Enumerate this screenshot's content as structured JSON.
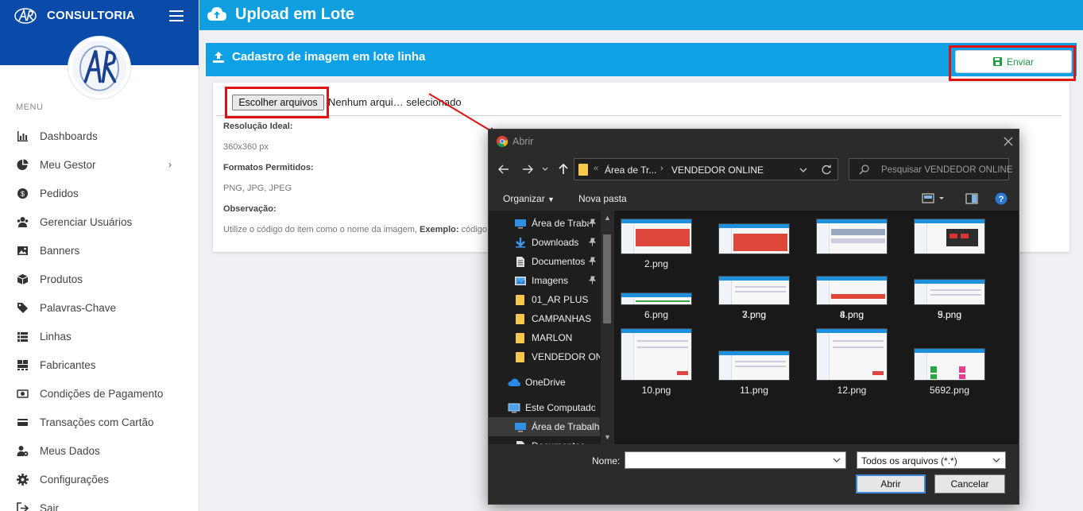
{
  "brand": {
    "name": "CONSULTORIA"
  },
  "sidebar": {
    "menu_title": "MENU",
    "items": [
      {
        "label": "Dashboards",
        "icon": "bar-chart-icon"
      },
      {
        "label": "Meu Gestor",
        "icon": "pie-chart-icon",
        "has_chevron": true
      },
      {
        "label": "Pedidos",
        "icon": "money-icon"
      },
      {
        "label": "Gerenciar Usuários",
        "icon": "users-icon"
      },
      {
        "label": "Banners",
        "icon": "image-icon"
      },
      {
        "label": "Produtos",
        "icon": "box-icon"
      },
      {
        "label": "Palavras-Chave",
        "icon": "tags-icon"
      },
      {
        "label": "Linhas",
        "icon": "list-icon"
      },
      {
        "label": "Fabricantes",
        "icon": "pallet-icon"
      },
      {
        "label": "Condições de Pagamento",
        "icon": "bill-icon"
      },
      {
        "label": "Transações com Cartão",
        "icon": "credit-card-icon"
      },
      {
        "label": "Meus Dados",
        "icon": "user-gear-icon"
      },
      {
        "label": "Configurações",
        "icon": "gear-icon"
      },
      {
        "label": "Sair",
        "icon": "exit-icon"
      }
    ]
  },
  "header": {
    "title": "Upload em Lote"
  },
  "panel": {
    "title": "Cadastro de imagem em lote linha",
    "send_label": "Enviar",
    "file_button": "Escolher arquivos",
    "file_status": "Nenhum arqui… selecionado",
    "res_label": "Resolução Ideal:",
    "res_value": "360x360 px",
    "formats_label": "Formatos Permitidos:",
    "formats_value": "PNG, JPG, JPEG",
    "obs_label": "Observação:",
    "obs_text": "Utilize o código do item como o nome da imagem,",
    "obs_example_label": "Exemplo:",
    "obs_example_text": "código d"
  },
  "dialog": {
    "title": "Abrir",
    "breadcrumb": [
      "Área de Tr...",
      "VENDEDOR ONLINE"
    ],
    "search_placeholder": "Pesquisar VENDEDOR ONLINE",
    "organize_label": "Organizar",
    "new_folder_label": "Nova pasta",
    "tree": [
      {
        "label": "Área de Trabalho",
        "icon": "desktop-icon",
        "pinned": true
      },
      {
        "label": "Downloads",
        "icon": "download-icon",
        "pinned": true
      },
      {
        "label": "Documentos",
        "icon": "document-icon",
        "pinned": true
      },
      {
        "label": "Imagens",
        "icon": "pictures-icon",
        "pinned": true
      },
      {
        "label": "01_AR PLUS",
        "icon": "folder-icon"
      },
      {
        "label": "CAMPANHAS",
        "icon": "folder-icon"
      },
      {
        "label": "MARLON",
        "icon": "folder-icon"
      },
      {
        "label": "VENDEDOR ONLINE",
        "icon": "folder-icon"
      },
      {
        "label": "OneDrive",
        "icon": "cloud-icon"
      },
      {
        "label": "Este Computador",
        "icon": "computer-icon"
      },
      {
        "label": "Área de Trabalho",
        "icon": "desktop-icon",
        "selected": true
      },
      {
        "label": "Documentos",
        "icon": "document-icon"
      }
    ],
    "files": [
      "2.png",
      "3.png",
      "4.png",
      "5.png",
      "6.png",
      "7.png",
      "8.png",
      "9.png",
      "10.png",
      "11.png",
      "12.png",
      "5692.png"
    ],
    "name_label": "Nome:",
    "name_value": "",
    "type_value": "Todos os arquivos (*.*)",
    "open_label": "Abrir",
    "cancel_label": "Cancelar"
  },
  "colors": {
    "brand_blue": "#0a4aa8",
    "header_blue": "#0f9fe0",
    "send_green": "#1e9b3e",
    "highlight_red": "#e01212"
  }
}
